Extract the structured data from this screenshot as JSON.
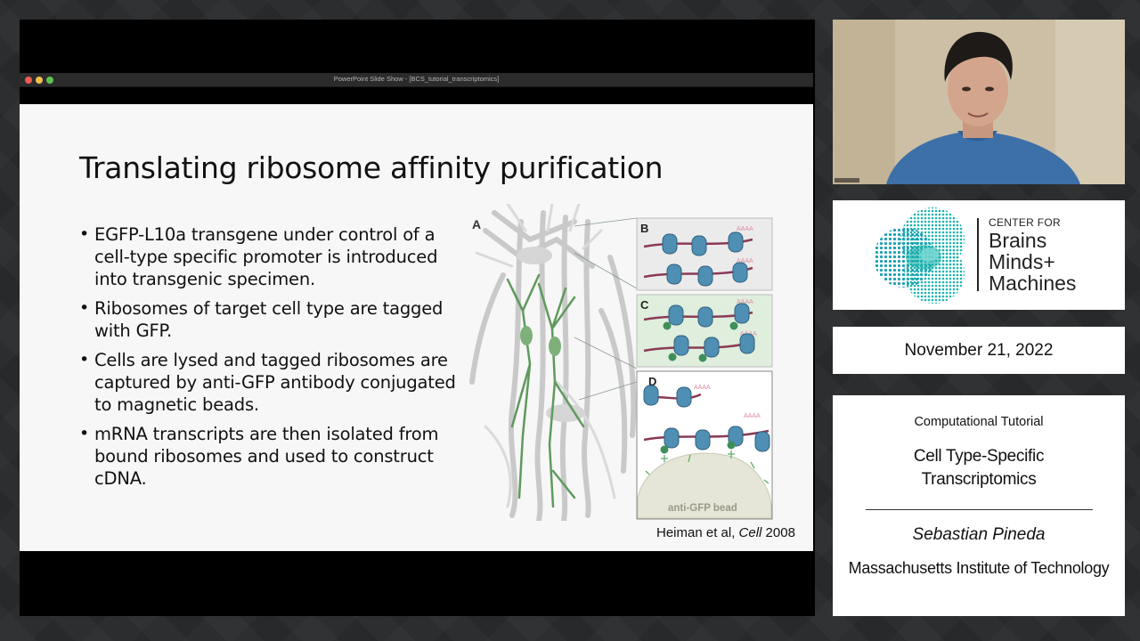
{
  "window": {
    "title": "PowerPoint Slide Show - [BCS_tutorial_transcriptomics]"
  },
  "slide": {
    "title": "Translating ribosome affinity purification",
    "bullets": [
      "EGFP-L10a transgene under control of a cell-type specific promoter is introduced into transgenic specimen.",
      "Ribosomes of target cell type are tagged with GFP.",
      "Cells are lysed and tagged ribosomes are captured by anti-GFP antibody conjugated to magnetic beads.",
      "mRNA transcripts are then isolated from bound ribosomes and used to construct cDNA."
    ],
    "citation_authors": "Heiman et al, ",
    "citation_journal": "Cell",
    "citation_year": " 2008",
    "figure": {
      "panel_a": "A",
      "panel_b": "B",
      "panel_c": "C",
      "panel_d": "D",
      "poly_a": "AAAA",
      "bead_label": "anti-GFP bead"
    }
  },
  "logo": {
    "line1": "CENTER FOR",
    "line2": "Brains",
    "line3": "Minds+",
    "line4": "Machines"
  },
  "date": "November 21, 2022",
  "info": {
    "kicker": "Computational Tutorial",
    "title_line1": "Cell Type-Specific",
    "title_line2": "Transcriptomics",
    "speaker": "Sebastian Pineda",
    "institution": "Massachusetts Institute of Technology"
  },
  "colors": {
    "ribosome": "#4f8fb4",
    "mrna": "#8a3a56",
    "gfp": "#3f8f5a",
    "neuron_green": "#5f9a5d",
    "logo_teal": "#1db3ad"
  }
}
